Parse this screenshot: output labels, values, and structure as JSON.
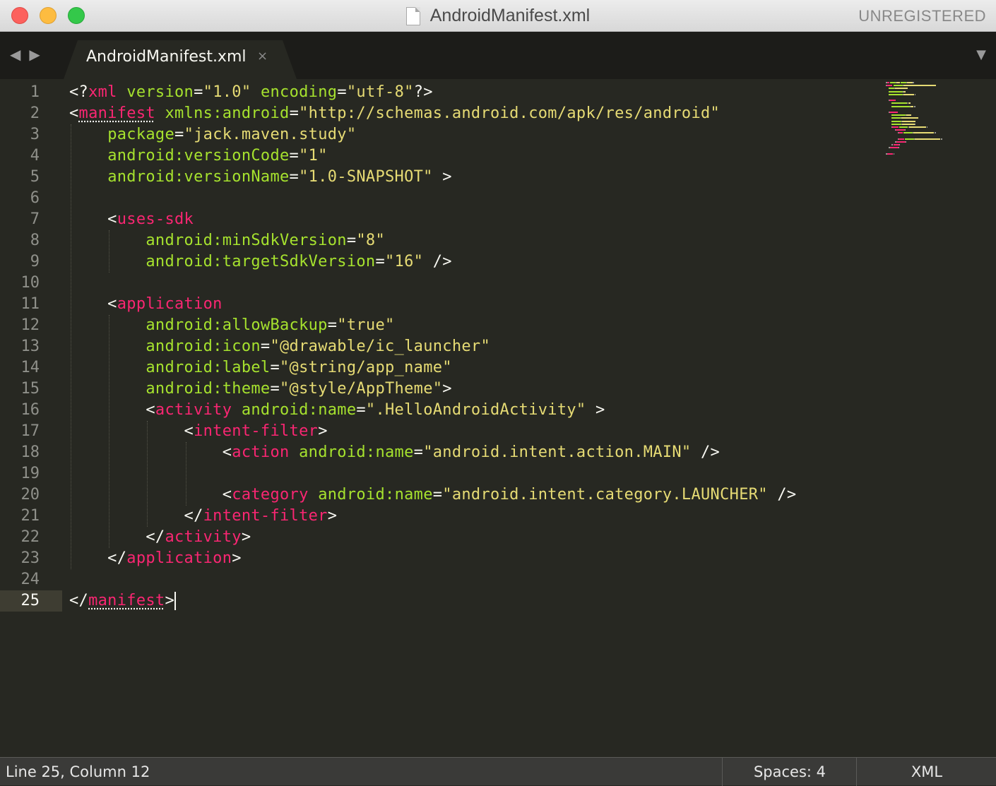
{
  "window": {
    "title": "AndroidManifest.xml",
    "license_label": "UNREGISTERED"
  },
  "tabbar": {
    "back_glyph": "◀",
    "forward_glyph": "▶",
    "dropdown_glyph": "▼",
    "tabs": [
      {
        "label": "AndroidManifest.xml",
        "close_glyph": "×",
        "active": true
      }
    ]
  },
  "editor": {
    "current_line": "25",
    "line_numbers": [
      "1",
      "2",
      "3",
      "4",
      "5",
      "6",
      "7",
      "8",
      "9",
      "10",
      "11",
      "12",
      "13",
      "14",
      "15",
      "16",
      "17",
      "18",
      "19",
      "20",
      "21",
      "22",
      "23",
      "24",
      "25"
    ],
    "lines": [
      {
        "t": [
          {
            "p": "<?"
          },
          {
            "tag": "xml"
          },
          {
            "p": " "
          },
          {
            "a": "version"
          },
          {
            "p": "="
          },
          {
            "s": "\"1.0\""
          },
          {
            "p": " "
          },
          {
            "a": "encoding"
          },
          {
            "p": "="
          },
          {
            "s": "\"utf-8\""
          },
          {
            "p": "?>"
          }
        ]
      },
      {
        "t": [
          {
            "p": "<"
          },
          {
            "tag": "manifest",
            "u": true
          },
          {
            "p": " "
          },
          {
            "a": "xmlns:android"
          },
          {
            "p": "="
          },
          {
            "s": "\"http://schemas.android.com/apk/res/android\""
          }
        ]
      },
      {
        "t": [
          {
            "p": "    "
          },
          {
            "a": "package"
          },
          {
            "p": "="
          },
          {
            "s": "\"jack.maven.study\""
          }
        ]
      },
      {
        "t": [
          {
            "p": "    "
          },
          {
            "a": "android:versionCode"
          },
          {
            "p": "="
          },
          {
            "s": "\"1\""
          }
        ]
      },
      {
        "t": [
          {
            "p": "    "
          },
          {
            "a": "android:versionName"
          },
          {
            "p": "="
          },
          {
            "s": "\"1.0-SNAPSHOT\""
          },
          {
            "p": " >"
          }
        ]
      },
      {
        "t": []
      },
      {
        "t": [
          {
            "p": "    <"
          },
          {
            "tag": "uses-sdk"
          }
        ]
      },
      {
        "t": [
          {
            "p": "        "
          },
          {
            "a": "android:minSdkVersion"
          },
          {
            "p": "="
          },
          {
            "s": "\"8\""
          }
        ]
      },
      {
        "t": [
          {
            "p": "        "
          },
          {
            "a": "android:targetSdkVersion"
          },
          {
            "p": "="
          },
          {
            "s": "\"16\""
          },
          {
            "p": " />"
          }
        ]
      },
      {
        "t": []
      },
      {
        "t": [
          {
            "p": "    <"
          },
          {
            "tag": "application"
          }
        ]
      },
      {
        "t": [
          {
            "p": "        "
          },
          {
            "a": "android:allowBackup"
          },
          {
            "p": "="
          },
          {
            "s": "\"true\""
          }
        ]
      },
      {
        "t": [
          {
            "p": "        "
          },
          {
            "a": "android:icon"
          },
          {
            "p": "="
          },
          {
            "s": "\"@drawable/ic_launcher\""
          }
        ]
      },
      {
        "t": [
          {
            "p": "        "
          },
          {
            "a": "android:label"
          },
          {
            "p": "="
          },
          {
            "s": "\"@string/app_name\""
          }
        ]
      },
      {
        "t": [
          {
            "p": "        "
          },
          {
            "a": "android:theme"
          },
          {
            "p": "="
          },
          {
            "s": "\"@style/AppTheme\""
          },
          {
            "p": ">"
          }
        ]
      },
      {
        "t": [
          {
            "p": "        <"
          },
          {
            "tag": "activity"
          },
          {
            "p": " "
          },
          {
            "a": "android:name"
          },
          {
            "p": "="
          },
          {
            "s": "\".HelloAndroidActivity\""
          },
          {
            "p": " >"
          }
        ]
      },
      {
        "t": [
          {
            "p": "            <"
          },
          {
            "tag": "intent-filter"
          },
          {
            "p": ">"
          }
        ]
      },
      {
        "t": [
          {
            "p": "                <"
          },
          {
            "tag": "action"
          },
          {
            "p": " "
          },
          {
            "a": "android:name"
          },
          {
            "p": "="
          },
          {
            "s": "\"android.intent.action.MAIN\""
          },
          {
            "p": " />"
          }
        ]
      },
      {
        "t": []
      },
      {
        "t": [
          {
            "p": "                <"
          },
          {
            "tag": "category"
          },
          {
            "p": " "
          },
          {
            "a": "android:name"
          },
          {
            "p": "="
          },
          {
            "s": "\"android.intent.category.LAUNCHER\""
          },
          {
            "p": " />"
          }
        ]
      },
      {
        "t": [
          {
            "p": "            </"
          },
          {
            "tag": "intent-filter"
          },
          {
            "p": ">"
          }
        ]
      },
      {
        "t": [
          {
            "p": "        </"
          },
          {
            "tag": "activity"
          },
          {
            "p": ">"
          }
        ]
      },
      {
        "t": [
          {
            "p": "    </"
          },
          {
            "tag": "application"
          },
          {
            "p": ">"
          }
        ]
      },
      {
        "t": []
      },
      {
        "t": [
          {
            "p": "</"
          },
          {
            "tag": "manifest",
            "u": true
          },
          {
            "p": ">"
          }
        ],
        "caret": true
      }
    ]
  },
  "statusbar": {
    "position": "Line 25, Column 12",
    "indentation": "Spaces: 4",
    "syntax": "XML"
  },
  "colors": {
    "background": "#272822",
    "tag": "#f92672",
    "attribute": "#a6e22e",
    "string": "#e6db74",
    "text": "#f8f8f2",
    "line_number": "#8f908a"
  }
}
